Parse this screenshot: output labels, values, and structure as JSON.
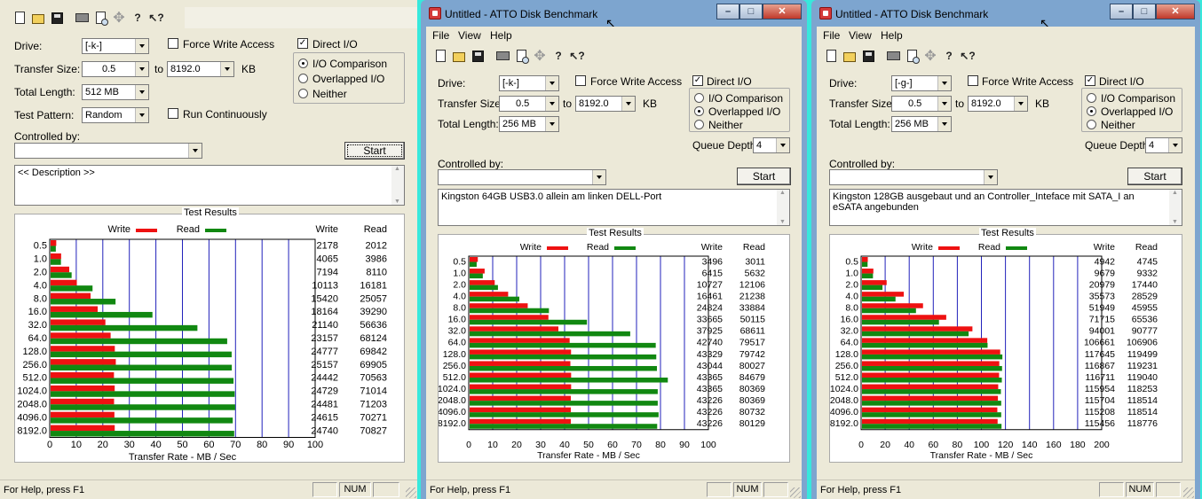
{
  "common": {
    "controlled_by_label": "Controlled by:",
    "drive_label": "Drive:",
    "transfer_size_label": "Transfer Size:",
    "to_label": "to",
    "kb_label": "KB",
    "total_length_label": "Total Length:",
    "test_pattern_label": "Test Pattern:",
    "force_write_label": "Force Write Access",
    "direct_io_label": "Direct I/O",
    "io_comparison_label": "I/O Comparison",
    "overlapped_label": "Overlapped I/O",
    "neither_label": "Neither",
    "run_continuously_label": "Run Continuously",
    "queue_depth_label": "Queue Depth:",
    "start_label": "Start",
    "test_results_label": "Test Results",
    "write_label": "Write",
    "read_label": "Read",
    "xaxis_label": "Transfer Rate - MB / Sec",
    "status_text": "For Help, press F1",
    "num_indicator": "NUM",
    "menu": [
      "File",
      "View",
      "Help"
    ],
    "colors": {
      "write": "#ee1111",
      "read": "#118811",
      "grid": "#2222bb",
      "desktop": "#38e8dc"
    }
  },
  "windows": [
    {
      "title": "",
      "drive": "[-k-]",
      "transfer_from": "0.5",
      "transfer_to": "8192.0",
      "total_length": "512 MB",
      "test_pattern": "Random",
      "force_write_checked": false,
      "direct_io_checked": true,
      "io_mode": "I/O Comparison",
      "queue_depth": "",
      "controlled_by": "",
      "description": "<< Description >>",
      "chart_data": {
        "type": "bar",
        "orientation": "horizontal",
        "xlabel": "Transfer Rate - MB / Sec",
        "xlim": [
          0,
          100
        ],
        "xticks": [
          0,
          10,
          20,
          30,
          40,
          50,
          60,
          70,
          80,
          90,
          100
        ],
        "categories": [
          "0.5",
          "1.0",
          "2.0",
          "4.0",
          "8.0",
          "16.0",
          "32.0",
          "64.0",
          "128.0",
          "256.0",
          "512.0",
          "1024.0",
          "2048.0",
          "4096.0",
          "8192.0"
        ],
        "series": [
          {
            "name": "Write",
            "values": [
              2178,
              4065,
              7194,
              10113,
              15420,
              18164,
              21140,
              23157,
              24777,
              25157,
              24442,
              24729,
              24481,
              24615,
              24740
            ]
          },
          {
            "name": "Read",
            "values": [
              2012,
              3986,
              8110,
              16181,
              25057,
              39290,
              56636,
              68124,
              69842,
              69905,
              70563,
              71014,
              71203,
              70271,
              70827
            ]
          }
        ],
        "value_unit": "KB/s"
      }
    },
    {
      "title": "Untitled - ATTO Disk Benchmark",
      "drive": "[-k-]",
      "transfer_from": "0.5",
      "transfer_to": "8192.0",
      "total_length": "256 MB",
      "test_pattern": "",
      "force_write_checked": false,
      "direct_io_checked": true,
      "io_mode": "Overlapped I/O",
      "queue_depth": "4",
      "controlled_by": "",
      "description": "Kingston 64GB USB3.0 allein am linken DELL-Port",
      "chart_data": {
        "type": "bar",
        "orientation": "horizontal",
        "xlabel": "Transfer Rate - MB / Sec",
        "xlim": [
          0,
          100
        ],
        "xticks": [
          0,
          10,
          20,
          30,
          40,
          50,
          60,
          70,
          80,
          90,
          100
        ],
        "categories": [
          "0.5",
          "1.0",
          "2.0",
          "4.0",
          "8.0",
          "16.0",
          "32.0",
          "64.0",
          "128.0",
          "256.0",
          "512.0",
          "1024.0",
          "2048.0",
          "4096.0",
          "8192.0"
        ],
        "series": [
          {
            "name": "Write",
            "values": [
              3496,
              6415,
              10727,
              16461,
              24824,
              33665,
              37925,
              42740,
              43329,
              43044,
              43365,
              43365,
              43226,
              43226,
              43226
            ]
          },
          {
            "name": "Read",
            "values": [
              3011,
              5632,
              12106,
              21238,
              33884,
              50115,
              68611,
              79517,
              79742,
              80027,
              84679,
              80369,
              80369,
              80732,
              80129
            ]
          }
        ],
        "value_unit": "KB/s"
      }
    },
    {
      "title": "Untitled - ATTO Disk Benchmark",
      "drive": "[-g-]",
      "transfer_from": "0.5",
      "transfer_to": "8192.0",
      "total_length": "256 MB",
      "test_pattern": "",
      "force_write_checked": false,
      "direct_io_checked": true,
      "io_mode": "Overlapped I/O",
      "queue_depth": "4",
      "controlled_by": "",
      "description": "Kingston 128GB ausgebaut und an Controller_Inteface mit SATA_I an eSATA angebunden",
      "chart_data": {
        "type": "bar",
        "orientation": "horizontal",
        "xlabel": "Transfer Rate - MB / Sec",
        "xlim": [
          0,
          200
        ],
        "xticks": [
          0,
          20,
          40,
          60,
          80,
          100,
          120,
          140,
          160,
          180,
          200
        ],
        "categories": [
          "0.5",
          "1.0",
          "2.0",
          "4.0",
          "8.0",
          "16.0",
          "32.0",
          "64.0",
          "128.0",
          "256.0",
          "512.0",
          "1024.0",
          "2048.0",
          "4096.0",
          "8192.0"
        ],
        "series": [
          {
            "name": "Write",
            "values": [
              4942,
              9679,
              20979,
              35573,
              51949,
              71715,
              94001,
              106661,
              117645,
              116867,
              116711,
              115954,
              115704,
              115208,
              115456
            ]
          },
          {
            "name": "Read",
            "values": [
              4745,
              9332,
              17440,
              28529,
              45955,
              65536,
              90777,
              106906,
              119499,
              119231,
              119040,
              118253,
              118514,
              118514,
              118776
            ]
          }
        ],
        "value_unit": "KB/s"
      }
    }
  ]
}
